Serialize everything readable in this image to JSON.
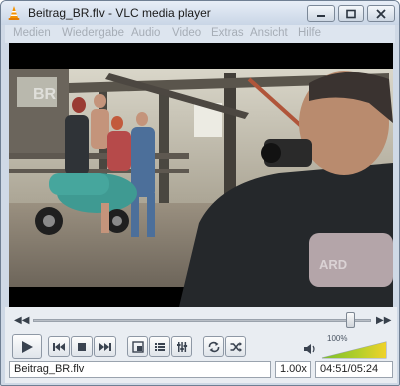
{
  "window": {
    "title": "Beitrag_BR.flv - VLC media player"
  },
  "menu": [
    "Medien",
    "Wiedergabe",
    "Audio",
    "Video",
    "Extras",
    "Ansicht",
    "Hilfe"
  ],
  "video": {
    "channel_logo": "BR",
    "watermark": "ARD"
  },
  "controls": {
    "seek_position": 0.94,
    "volume_label": "100%",
    "volume_level": 1.0
  },
  "status": {
    "filename": "Beitrag_BR.flv",
    "speed": "1.00x",
    "time": "04:51/05:24"
  },
  "colors": {
    "accent_vlc_orange": "#f39200",
    "volume_green": "#7bbf2b",
    "volume_yellow": "#f0d22a"
  }
}
